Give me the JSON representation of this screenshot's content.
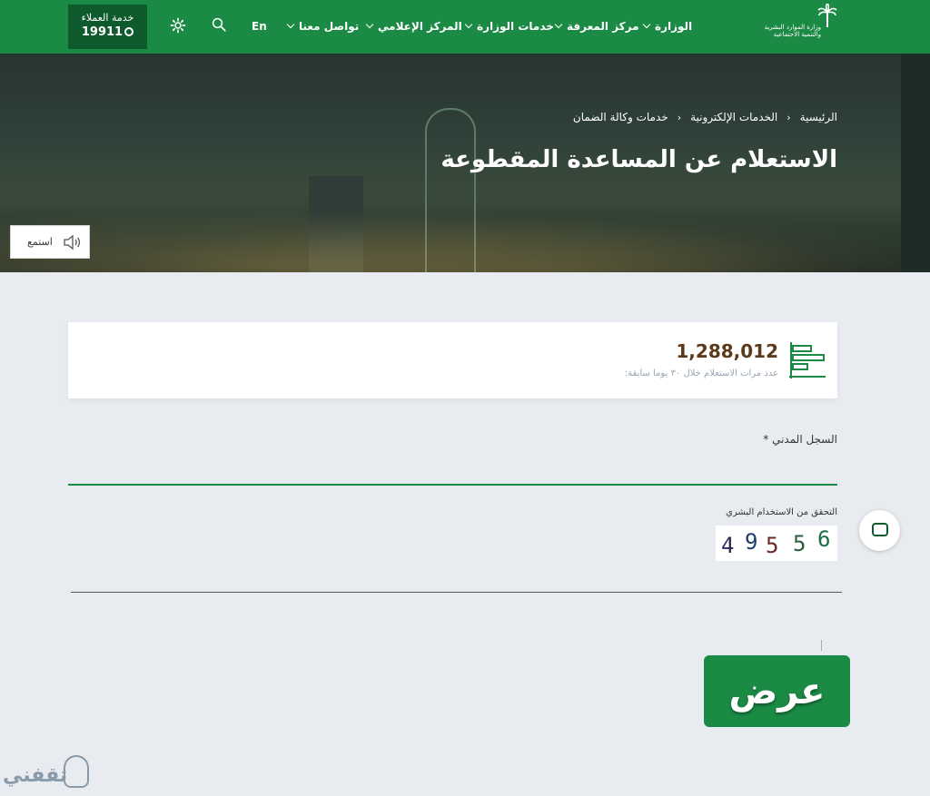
{
  "header": {
    "customer_service_label": "خدمة العملاء",
    "customer_service_number": "19911",
    "lang_toggle": "En",
    "nav": [
      {
        "label": "الوزارة"
      },
      {
        "label": "مركز المعرفة"
      },
      {
        "label": "خدمات الوزارة"
      },
      {
        "label": "المركز الإعلامي"
      },
      {
        "label": "تواصل معنا"
      }
    ],
    "logo_text": "وزارة الموارد البشرية والتنمية الاجتماعية"
  },
  "hero": {
    "breadcrumb": [
      "الرئيسية",
      "الخدمات الإلكترونية",
      "خدمات وكالة الضمان"
    ],
    "title": "الاستعلام عن المساعدة المقطوعة",
    "listen_label": "استمع"
  },
  "stats": {
    "count": "1,288,012",
    "caption": "عدد مرات الاستعلام خلال ٣٠ يوما سابقة:"
  },
  "form": {
    "id_label": "السجل المدني",
    "required_mark": "*",
    "id_value": "",
    "captcha_label": "التحقق من الاستخدام البشري",
    "captcha_digits": [
      "4",
      "9",
      "5",
      "5",
      "6"
    ],
    "captcha_colors": [
      "#2a2a5a",
      "#1f3d6b",
      "#6b2a2a",
      "#2b5e3a",
      "#1b6e4a"
    ],
    "captcha_value": "",
    "submit_label": "عرض"
  },
  "watermark": {
    "text": "ثقفني"
  },
  "colors": {
    "primary": "#1b8a45",
    "dark": "#0f5a2c",
    "page_bg": "#e8ecf0"
  }
}
